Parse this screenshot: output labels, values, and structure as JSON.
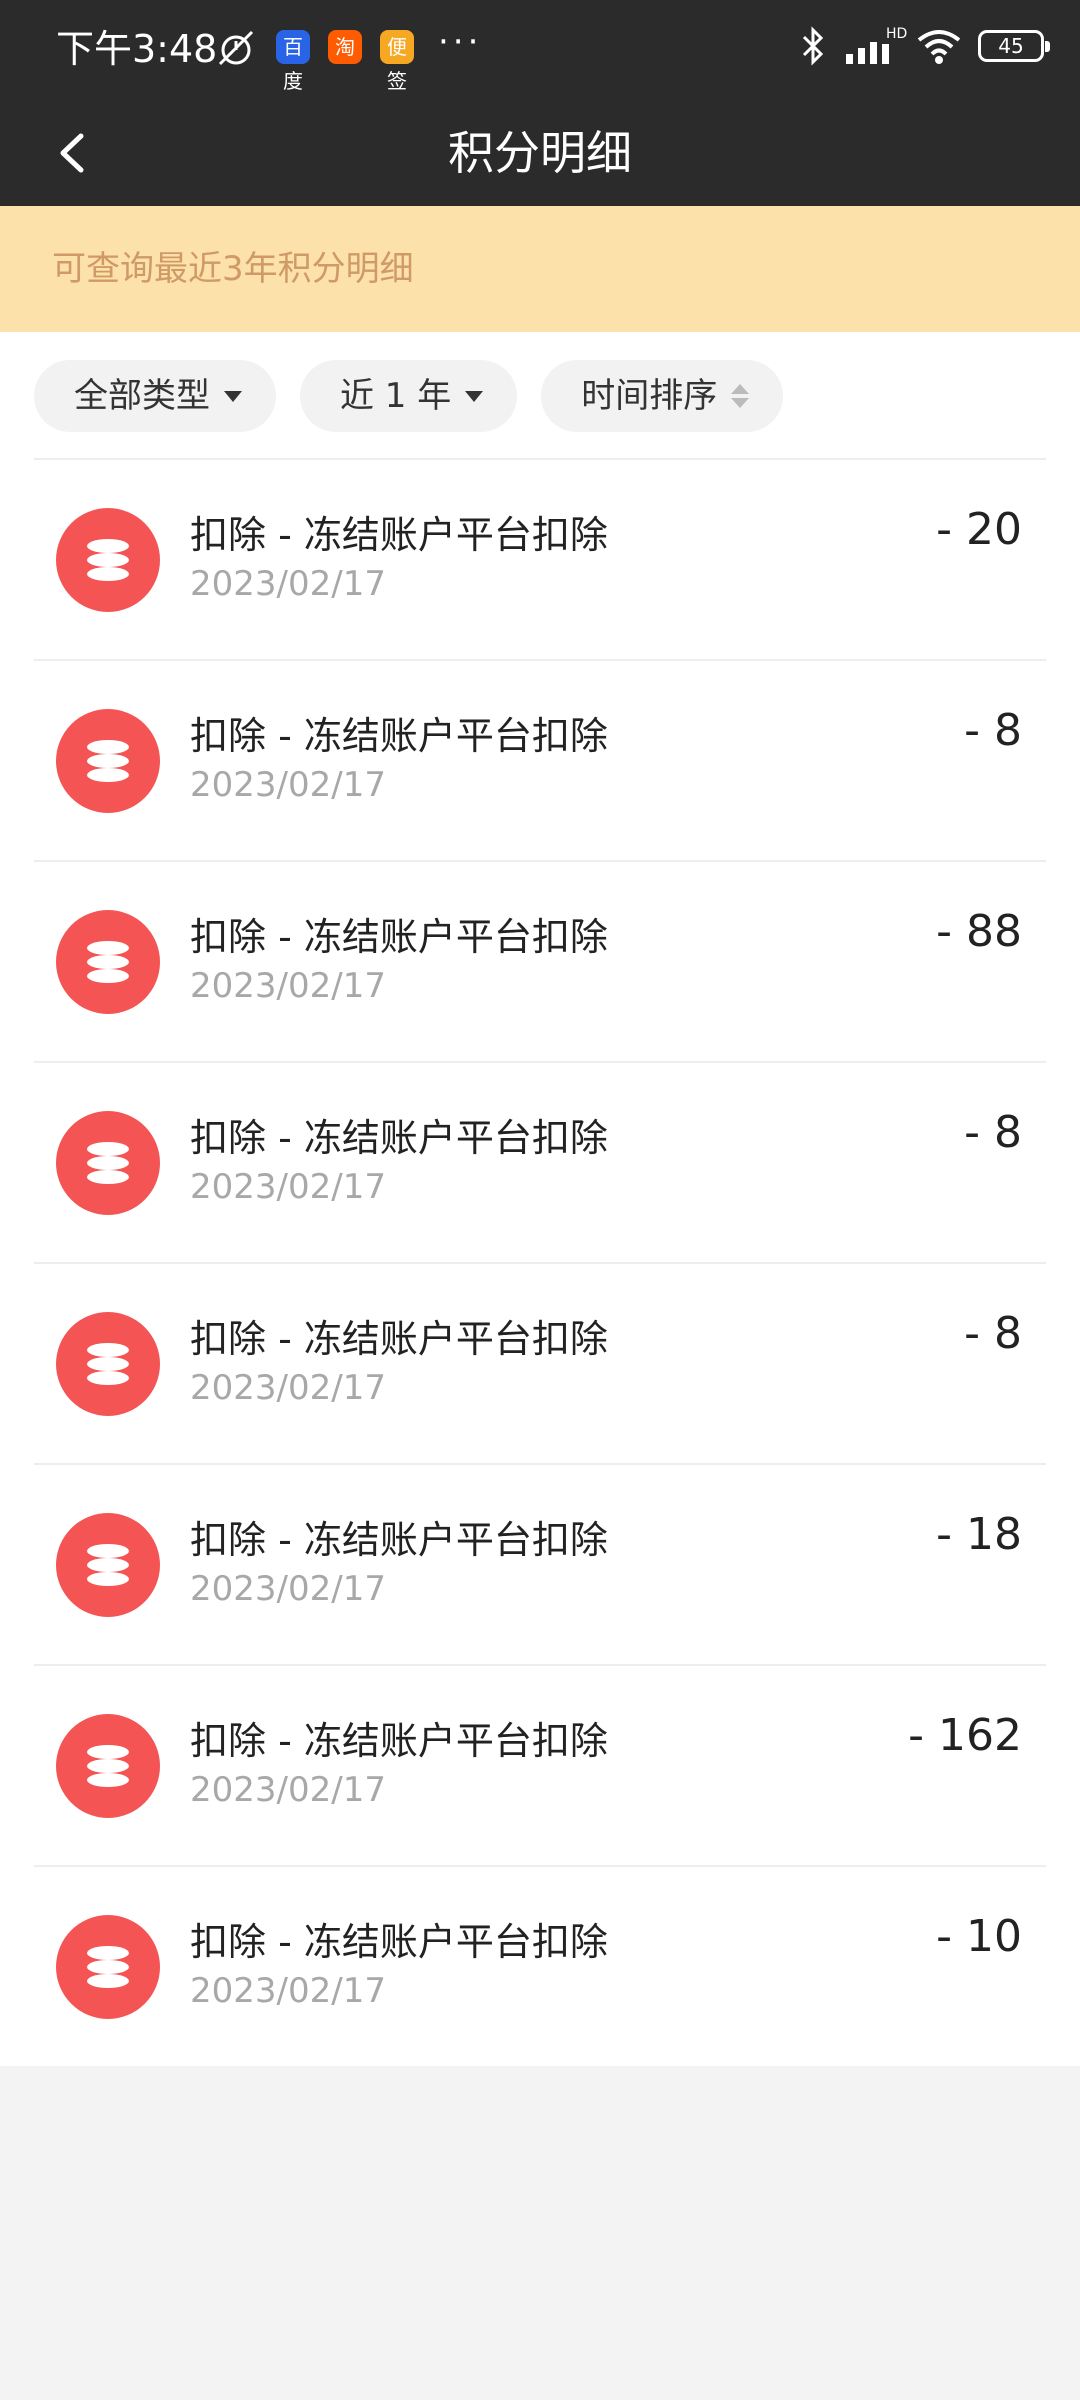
{
  "status_bar": {
    "time": "下午3:48",
    "apps": [
      "百度",
      "淘",
      "便签"
    ],
    "more": "···",
    "network": "HD",
    "battery": "45"
  },
  "nav": {
    "title": "积分明细"
  },
  "notice": "可查询最近3年积分明细",
  "filters": [
    {
      "label": "全部类型"
    },
    {
      "label": "近 1 年"
    },
    {
      "label": "时间排序"
    }
  ],
  "records": [
    {
      "title": "扣除 - 冻结账户平台扣除",
      "date": "2023/02/17",
      "amount": "- 20"
    },
    {
      "title": "扣除 - 冻结账户平台扣除",
      "date": "2023/02/17",
      "amount": "- 8"
    },
    {
      "title": "扣除 - 冻结账户平台扣除",
      "date": "2023/02/17",
      "amount": "- 88"
    },
    {
      "title": "扣除 - 冻结账户平台扣除",
      "date": "2023/02/17",
      "amount": "- 8"
    },
    {
      "title": "扣除 - 冻结账户平台扣除",
      "date": "2023/02/17",
      "amount": "- 8"
    },
    {
      "title": "扣除 - 冻结账户平台扣除",
      "date": "2023/02/17",
      "amount": "- 18"
    },
    {
      "title": "扣除 - 冻结账户平台扣除",
      "date": "2023/02/17",
      "amount": "- 162"
    },
    {
      "title": "扣除 - 冻结账户平台扣除",
      "date": "2023/02/17",
      "amount": "- 10"
    }
  ],
  "icons": {
    "back": "chevron-left-icon",
    "record": "coins-stack-icon"
  },
  "colors": {
    "header_bg": "#2b2b2b",
    "notice_bg": "#fde1aa",
    "notice_text": "#d09a66",
    "record_icon_bg": "#f45554"
  }
}
